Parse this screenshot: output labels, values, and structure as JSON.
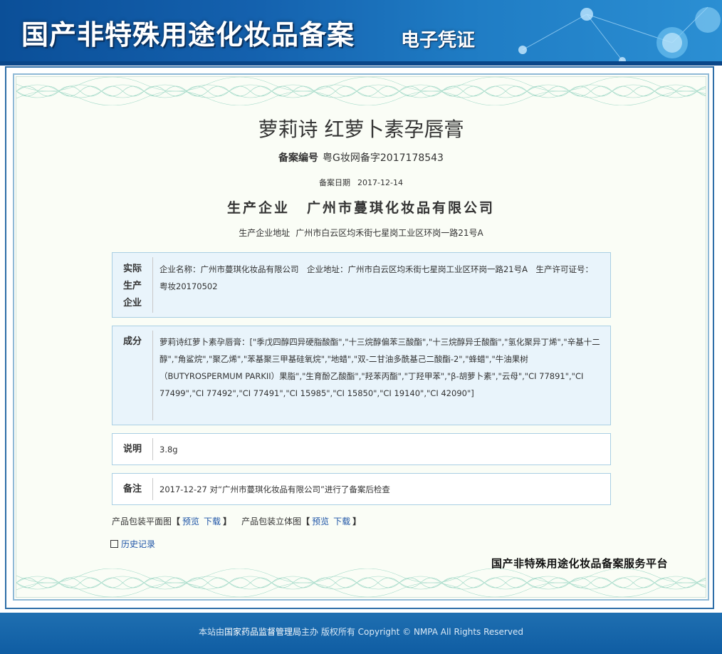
{
  "header": {
    "title": "国产非特殊用途化妆品备案",
    "subtitle": "电子凭证"
  },
  "certificate": {
    "product_name": "萝莉诗 红萝卜素孕唇膏",
    "record_no_label": "备案编号",
    "record_no": "粤G妆网备字2017178543",
    "record_date_label": "备案日期",
    "record_date": "2017-12-14",
    "enterprise_label": "生产企业",
    "enterprise_name": "广州市蔓琪化妆品有限公司",
    "enterprise_addr_label": "生产企业地址",
    "enterprise_addr": "广州市白云区均禾街七星岗工业区环岗一路21号A"
  },
  "sections": {
    "actual_producer": {
      "label_line1": "实际",
      "label_line2": "生产",
      "label_line3": "企业",
      "content": "企业名称：广州市蔓琪化妆品有限公司　企业地址：广州市白云区均禾街七星岗工业区环岗一路21号A　生产许可证号：粤妆20170502"
    },
    "ingredients": {
      "label": "成分",
      "content": "萝莉诗红萝卜素孕唇膏：[\"季戊四醇四异硬脂酸酯\",\"十三烷醇偏苯三酸酯\",\"十三烷醇异壬酸酯\",\"氢化聚异丁烯\",\"辛基十二醇\",\"角鲨烷\",\"聚乙烯\",\"苯基聚三甲基硅氧烷\",\"地蜡\",\"双-二甘油多酰基己二酸酯-2\",\"蜂蜡\",\"牛油果树（BUTYROSPERMUM PARKII）果脂\",\"生育酚乙酸酯\",\"羟苯丙酯\",\"丁羟甲苯\",\"β-胡萝卜素\",\"云母\",\"CI 77891\",\"CI 77499\",\"CI 77492\",\"CI 77491\",\"CI 15985\",\"CI 15850\",\"CI 19140\",\"CI 42090\"]"
    },
    "description": {
      "label": "说明",
      "content": "3.8g"
    },
    "remarks": {
      "label": "备注",
      "content": "2017-12-27 对“广州市蔓琪化妆品有限公司”进行了备案后检查"
    }
  },
  "packaging": {
    "flat_label": "产品包装平面图",
    "stereo_label": "产品包装立体图",
    "bracket_open": "【",
    "bracket_close": "】",
    "preview": "预览",
    "download": "下载"
  },
  "history_link": "历史记录",
  "platform_name": "国产非特殊用途化妆品备案服务平台",
  "footer": {
    "prefix": "本站由",
    "org": "国家药品监督管理局",
    "suffix": "主办 版权所有 Copyright © NMPA All Rights Reserved"
  },
  "colors": {
    "header_blue": "#1461ae",
    "link_blue": "#1f55a7",
    "box_fill": "#e9f4fb",
    "box_border": "#a9cfe3"
  }
}
